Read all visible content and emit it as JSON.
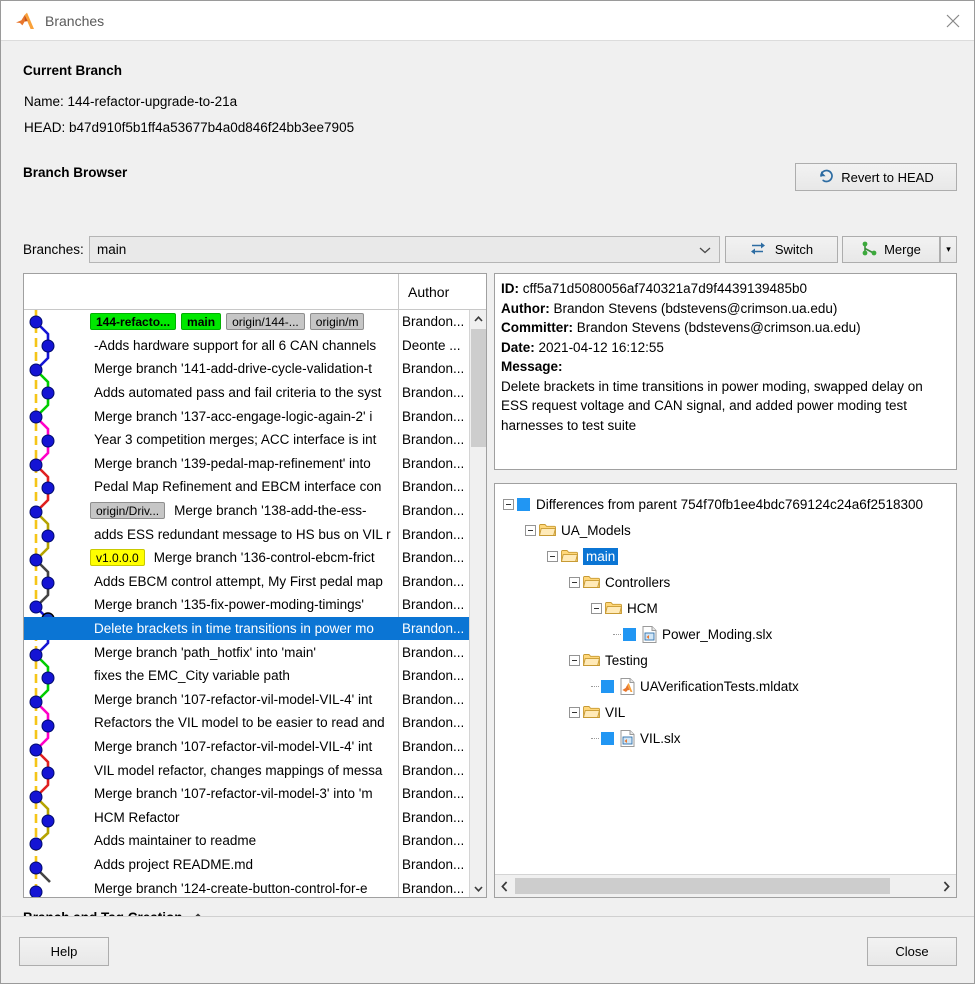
{
  "window": {
    "title": "Branches",
    "app_icon": "matlab-icon",
    "close_icon": "close-icon"
  },
  "current_branch": {
    "heading": "Current Branch",
    "name_label": "Name:",
    "name_value": "144-refactor-upgrade-to-21a",
    "head_label": "HEAD:",
    "head_value": "b47d910f5b1ff4a53677b4a0d846f24bb3ee7905",
    "revert_button": "Revert to HEAD"
  },
  "branch_browser": {
    "heading": "Branch Browser",
    "branches_label": "Branches:",
    "branches_value": "main",
    "switch_button": "Switch",
    "merge_button": "Merge",
    "merge_dropdown_caret": "▾"
  },
  "commit_list": {
    "columns": [
      "",
      "Author"
    ],
    "rows": [
      {
        "chips": [
          {
            "text": "144-refacto...",
            "kind": "branch"
          },
          {
            "text": "main",
            "kind": "branch"
          },
          {
            "text": "origin/144-...",
            "kind": "remote"
          },
          {
            "text": "origin/m",
            "kind": "remote"
          }
        ],
        "message": "",
        "author": "Brandon...",
        "selected": false
      },
      {
        "chips": [],
        "message": "-Adds hardware support for all 6 CAN channels",
        "author": "Deonte ...",
        "selected": false
      },
      {
        "chips": [],
        "message": "Merge branch '141-add-drive-cycle-validation-t",
        "author": "Brandon...",
        "selected": false
      },
      {
        "chips": [],
        "message": "Adds automated pass and fail criteria to the syst",
        "author": "Brandon...",
        "selected": false
      },
      {
        "chips": [],
        "message": "Merge branch '137-acc-engage-logic-again-2' i",
        "author": "Brandon...",
        "selected": false
      },
      {
        "chips": [],
        "message": "Year 3 competition merges; ACC interface is int",
        "author": "Brandon...",
        "selected": false
      },
      {
        "chips": [],
        "message": "Merge branch '139-pedal-map-refinement' into",
        "author": "Brandon...",
        "selected": false
      },
      {
        "chips": [],
        "message": "Pedal Map Refinement and EBCM interface con",
        "author": "Brandon...",
        "selected": false
      },
      {
        "chips": [
          {
            "text": "origin/Driv...",
            "kind": "remote"
          }
        ],
        "message": "Merge branch '138-add-the-ess-",
        "author": "Brandon...",
        "selected": false
      },
      {
        "chips": [],
        "message": "adds ESS redundant message to HS bus on VIL r",
        "author": "Brandon...",
        "selected": false
      },
      {
        "chips": [
          {
            "text": "v1.0.0.0",
            "kind": "tag"
          }
        ],
        "message": "Merge branch '136-control-ebcm-frict",
        "author": "Brandon...",
        "selected": false
      },
      {
        "chips": [],
        "message": "Adds EBCM control attempt, My First pedal map",
        "author": "Brandon...",
        "selected": false
      },
      {
        "chips": [],
        "message": "Merge branch '135-fix-power-moding-timings'",
        "author": "Brandon...",
        "selected": false
      },
      {
        "chips": [],
        "message": "Delete brackets in time transitions in power mo",
        "author": "Brandon...",
        "selected": true
      },
      {
        "chips": [],
        "message": "Merge branch 'path_hotfix' into 'main'",
        "author": "Brandon...",
        "selected": false
      },
      {
        "chips": [],
        "message": "fixes the EMC_City variable path",
        "author": "Brandon...",
        "selected": false
      },
      {
        "chips": [],
        "message": "Merge branch '107-refactor-vil-model-VIL-4' int",
        "author": "Brandon...",
        "selected": false
      },
      {
        "chips": [],
        "message": "Refactors the VIL model to be easier to read and",
        "author": "Brandon...",
        "selected": false
      },
      {
        "chips": [],
        "message": "Merge branch '107-refactor-vil-model-VIL-4' int",
        "author": "Brandon...",
        "selected": false
      },
      {
        "chips": [],
        "message": "VIL model refactor, changes mappings of messa",
        "author": "Brandon...",
        "selected": false
      },
      {
        "chips": [],
        "message": "Merge branch '107-refactor-vil-model-3' into 'm",
        "author": "Brandon...",
        "selected": false
      },
      {
        "chips": [],
        "message": "HCM Refactor",
        "author": "Brandon...",
        "selected": false
      },
      {
        "chips": [],
        "message": "Adds maintainer to readme",
        "author": "Brandon...",
        "selected": false
      },
      {
        "chips": [],
        "message": "Adds project README.md",
        "author": "Brandon...",
        "selected": false
      },
      {
        "chips": [],
        "message": "Merge branch '124-create-button-control-for-e",
        "author": "Brandon...",
        "selected": false
      }
    ]
  },
  "commit_detail": {
    "id_label": "ID:",
    "id_value": "cff5a71d5080056af740321a7d9f4439139485b0",
    "author_label": "Author:",
    "author_value": "Brandon Stevens (bdstevens@crimson.ua.edu)",
    "committer_label": "Committer:",
    "committer_value": "Brandon Stevens (bdstevens@crimson.ua.edu)",
    "date_label": "Date:",
    "date_value": "2021-04-12 16:12:55",
    "message_label": "Message:",
    "message_value": "Delete brackets in time transitions in power moding, swapped delay on ESS request voltage and CAN signal, and added power moding test harnesses to test suite"
  },
  "diff_tree": {
    "nodes": [
      {
        "depth": 0,
        "label": "Differences from parent 754f70fb1ee4bdc769124c24a6f2518300",
        "icon": "blue-square-icon",
        "expander": true,
        "selected": false
      },
      {
        "depth": 1,
        "label": "UA_Models",
        "icon": "folder-icon",
        "expander": true,
        "selected": false
      },
      {
        "depth": 2,
        "label": "main",
        "icon": "folder-icon",
        "expander": true,
        "selected": true
      },
      {
        "depth": 3,
        "label": "Controllers",
        "icon": "folder-icon",
        "expander": true,
        "selected": false
      },
      {
        "depth": 4,
        "label": "HCM",
        "icon": "folder-icon",
        "expander": true,
        "selected": false
      },
      {
        "depth": 5,
        "label": "Power_Moding.slx",
        "icon": "simulink-file-icon",
        "expander": false,
        "selected": false
      },
      {
        "depth": 3,
        "label": "Testing",
        "icon": "folder-icon",
        "expander": true,
        "selected": false
      },
      {
        "depth": 4,
        "label": "UAVerificationTests.mldatx",
        "icon": "matlab-file-icon",
        "expander": false,
        "selected": false
      },
      {
        "depth": 3,
        "label": "VIL",
        "icon": "folder-icon",
        "expander": true,
        "selected": false
      },
      {
        "depth": 4,
        "label": "VIL.slx",
        "icon": "simulink-file-icon",
        "expander": false,
        "selected": false
      }
    ]
  },
  "branch_tag_creation": {
    "title": "Branch and Tag Creation",
    "caret": "chevron-up-icon"
  },
  "footer": {
    "help_button": "Help",
    "close_button": "Close"
  },
  "colors": {
    "selection_blue": "#0b75d4",
    "branch_green": "#00e800",
    "tag_yellow": "#ffff00",
    "remote_grey": "#c6c6c6",
    "panel_bg": "#f0f0f0",
    "graph_main": "#f5c518"
  }
}
